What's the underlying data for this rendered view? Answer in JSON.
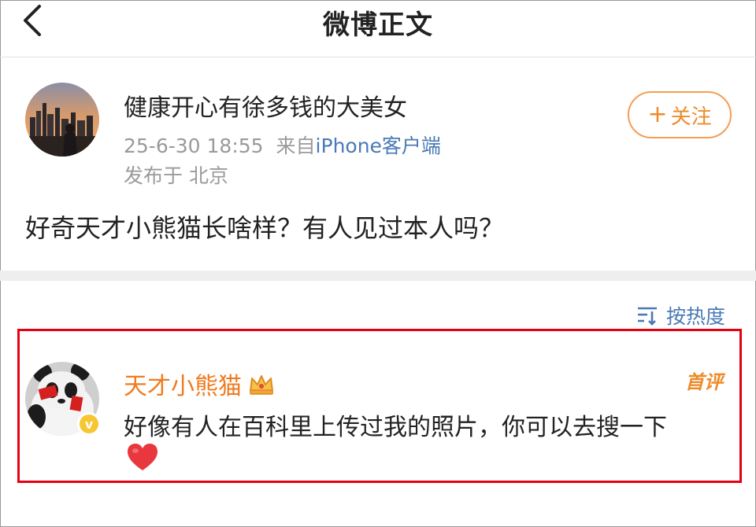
{
  "header": {
    "title": "微博正文",
    "back_icon": "chevron-left-icon"
  },
  "post": {
    "author_name": "健康开心有徐多钱的大美女",
    "timestamp": "25-6-30 18:55",
    "source_prefix": "来自",
    "source": "iPhone客户端",
    "location": "发布于 北京",
    "follow_label": "关注",
    "body": "好奇天才小熊猫长啥样？有人见过本人吗？"
  },
  "comments": {
    "sort_label": "按热度",
    "sort_icon": "sort-icon",
    "items": [
      {
        "name": "天才小熊猫",
        "badge": "首评",
        "text": "好像有人在百科里上传过我的照片，你可以去搜一下",
        "verified_mark": "v",
        "emoji": "heart-icon"
      }
    ]
  },
  "colors": {
    "accent_orange": "#ef8a2a",
    "link_blue": "#4a7ab5",
    "highlight_red": "#e60012",
    "verified_yellow": "#f7c631"
  }
}
